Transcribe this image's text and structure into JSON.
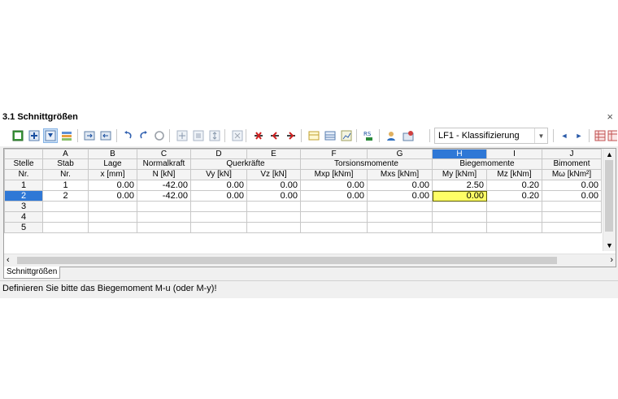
{
  "window": {
    "title": "3.1 Schnittgrößen",
    "close_label": "×"
  },
  "toolbar": {
    "combo_value": "LF1 - Klassifizierung",
    "prev_label": "◄",
    "next_label": "►"
  },
  "grid": {
    "letters": [
      "A",
      "B",
      "C",
      "D",
      "E",
      "F",
      "G",
      "H",
      "I",
      "J"
    ],
    "groups": [
      "Stelle",
      "Stab",
      "Lage",
      "Normalkraft",
      "Querkräfte",
      "Torsionsmomente",
      "Biegemomente",
      "Bimoment"
    ],
    "sub": [
      "Nr.",
      "Nr.",
      "x [mm]",
      "N [kN]",
      "Vy [kN]",
      "Vz [kN]",
      "Mxp [kNm]",
      "Mxs [kNm]",
      "My [kNm]",
      "Mz [kNm]",
      "Mω [kNm²]"
    ],
    "rows": [
      {
        "nr": "1",
        "stab": "1",
        "x": "0.00",
        "n": "-42.00",
        "vy": "0.00",
        "vz": "0.00",
        "mxp": "0.00",
        "mxs": "0.00",
        "my": "2.50",
        "mz": "0.20",
        "mw": "0.00"
      },
      {
        "nr": "2",
        "stab": "2",
        "x": "0.00",
        "n": "-42.00",
        "vy": "0.00",
        "vz": "0.00",
        "mxp": "0.00",
        "mxs": "0.00",
        "my": "0.00",
        "mz": "0.20",
        "mw": "0.00"
      },
      {
        "nr": "3",
        "stab": "",
        "x": "",
        "n": "",
        "vy": "",
        "vz": "",
        "mxp": "",
        "mxs": "",
        "my": "",
        "mz": "",
        "mw": ""
      },
      {
        "nr": "4",
        "stab": "",
        "x": "",
        "n": "",
        "vy": "",
        "vz": "",
        "mxp": "",
        "mxs": "",
        "my": "",
        "mz": "",
        "mw": ""
      },
      {
        "nr": "5",
        "stab": "",
        "x": "",
        "n": "",
        "vy": "",
        "vz": "",
        "mxp": "",
        "mxs": "",
        "my": "",
        "mz": "",
        "mw": ""
      }
    ]
  },
  "tabs": [
    {
      "label": "Schnittgrößen"
    }
  ],
  "status": {
    "text": "Definieren Sie bitte das Biegemoment M-u (oder M-y)!"
  },
  "colors": {
    "selection": "#2f78d6",
    "highlight": "#ffff66"
  }
}
